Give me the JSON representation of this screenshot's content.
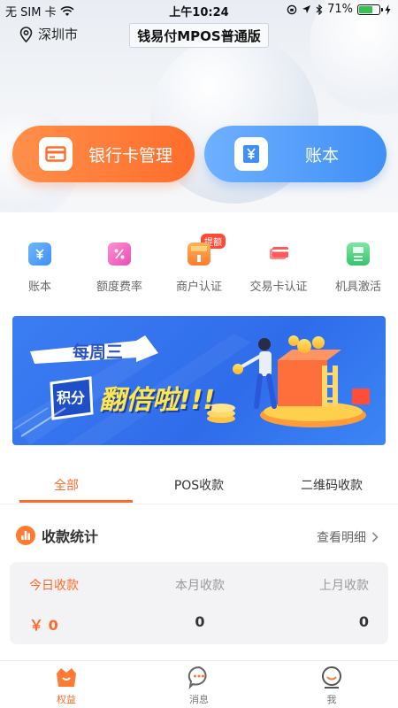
{
  "status_bar": {
    "carrier": "无 SIM 卡",
    "time": "上午10:24",
    "battery": "71%",
    "battery_level": 0.71
  },
  "header": {
    "location": "深圳市",
    "app_title": "钱易付MPOS普通版"
  },
  "actions": {
    "bank_card": "银行卡管理",
    "ledger": "账本"
  },
  "quick_menu": [
    {
      "label": "账本",
      "icon": "ledger-icon"
    },
    {
      "label": "额度费率",
      "icon": "percent-icon"
    },
    {
      "label": "商户认证",
      "icon": "shop-icon",
      "badge": "提额"
    },
    {
      "label": "交易卡认证",
      "icon": "card-icon"
    },
    {
      "label": "机具激活",
      "icon": "pos-device-icon"
    }
  ],
  "banner": {
    "line1": "每周三",
    "tag": "积分",
    "headline": "翻倍啦!!!"
  },
  "tabs": [
    "全部",
    "POS收款",
    "二维码收款"
  ],
  "stats": {
    "title": "收款统计",
    "detail_link": "查看明细",
    "today_label": "今日收款",
    "today_value": "￥ 0",
    "month_label": "本月收款",
    "month_value": "0",
    "last_month_label": "上月收款",
    "last_month_value": "0"
  },
  "tabbar": [
    "权益",
    "消息",
    "我"
  ],
  "colors": {
    "accent_orange": "#ff6a2a",
    "accent_blue": "#3f8ff6"
  }
}
